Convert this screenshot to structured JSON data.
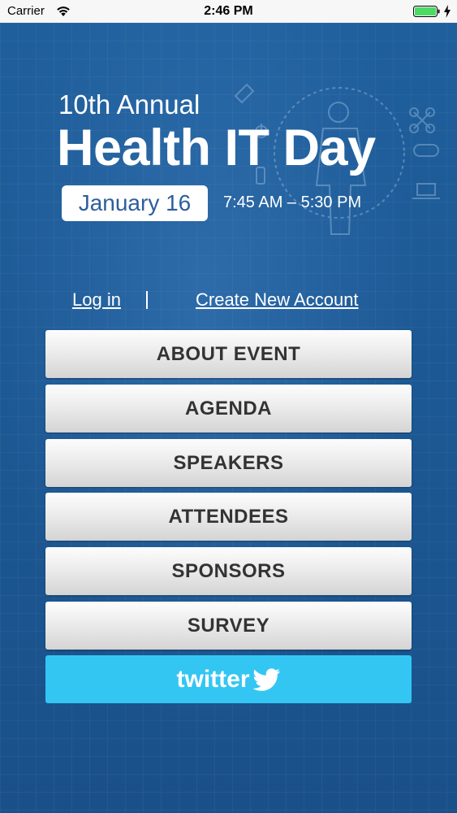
{
  "status_bar": {
    "carrier": "Carrier",
    "time": "2:46 PM"
  },
  "header": {
    "annual": "10th Annual",
    "title": "Health IT Day",
    "date": "January 16",
    "time_range": "7:45 AM – 5:30 PM"
  },
  "auth": {
    "login": "Log in",
    "create_account": "Create New Account"
  },
  "menu": [
    {
      "label": "ABOUT EVENT"
    },
    {
      "label": "AGENDA"
    },
    {
      "label": "SPEAKERS"
    },
    {
      "label": "ATTENDEES"
    },
    {
      "label": "SPONSORS"
    },
    {
      "label": "SURVEY"
    }
  ],
  "twitter": {
    "wordmark": "twitter",
    "icon": "twitter-bird-icon",
    "color": "#33c6f3"
  },
  "colors": {
    "background": "#1e5a96",
    "battery": "#4cd964",
    "date_text": "#2c5f9c"
  }
}
